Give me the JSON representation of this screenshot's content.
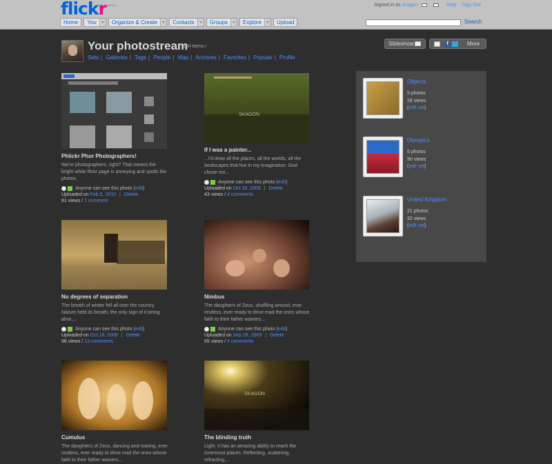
{
  "header": {
    "logo_main": "flick",
    "logo_r": "r",
    "logo_tag": "FROM YAHOO",
    "signed_in_label": "Signed in as",
    "signed_in_user": "skagon",
    "help": "Help",
    "sign_out": "Sign Out",
    "nav": [
      {
        "label": "Home",
        "dropdown": false
      },
      {
        "label": "You",
        "dropdown": true
      },
      {
        "label": "Organize & Create",
        "dropdown": true
      },
      {
        "label": "Contacts",
        "dropdown": true
      },
      {
        "label": "Groups",
        "dropdown": true
      },
      {
        "label": "Explore",
        "dropdown": true
      },
      {
        "label": "Upload",
        "dropdown": false
      }
    ],
    "search_value": "",
    "search_label": "Search"
  },
  "profile": {
    "title": "Your photostream",
    "count": "190 items /",
    "links": [
      "Sets",
      "Galleries",
      "Tags",
      "People",
      "Map",
      "Archives",
      "Favorites",
      "Popular",
      "Profile"
    ],
    "slideshow": "Slideshow",
    "more": "More"
  },
  "photos": [
    {
      "title": "Phlickr Phor Photographers!",
      "desc": "We're photographers, right? That means the bright white flickr page is annoying and spoils the photos.",
      "privacy": "Anyone can see this photo",
      "edit": "edit",
      "uploaded_label": "Uploaded on",
      "date": "Feb 5, 2010",
      "delete": "Delete",
      "views": "81 views /",
      "comments": "1 comment"
    },
    {
      "title": "If I was a painter...",
      "desc": "...I'd draw all the places, all the worlds, all the landscapes that live in my imagination. God chose not...",
      "privacy": "Anyone can see this photo",
      "edit": "edit",
      "uploaded_label": "Uploaded on",
      "date": "Oct 18, 2009",
      "delete": "Delete",
      "views": "43 views /",
      "comments": "4 comments"
    },
    {
      "title": "No degrees of separation",
      "desc": "The breath of winter fell all over the country. Nature held its breath; the only sign of it being alive,...",
      "privacy": "Anyone can see this photo",
      "edit": "edit",
      "uploaded_label": "Uploaded on",
      "date": "Oct 18, 2009",
      "delete": "Delete",
      "views": "96 views /",
      "comments": "13 comments"
    },
    {
      "title": "Nimbus",
      "desc": "The daughters of Zeus, shuffling around, ever restless, ever ready to drive mad the ones whose faith to their father waivers...",
      "privacy": "Anyone can see this photo",
      "edit": "edit",
      "uploaded_label": "Uploaded on",
      "date": "Sep 26, 2009",
      "delete": "Delete",
      "views": "65 views /",
      "comments": "5 comments"
    },
    {
      "title": "Cumulus",
      "desc": "The daughters of Zeus, dancing and roaring, ever restless, ever ready to drive mad the ones whose faith to their father waivers...",
      "privacy": "",
      "edit": "",
      "uploaded_label": "",
      "date": "",
      "delete": "",
      "views": "",
      "comments": ""
    },
    {
      "title": "The blinding truth",
      "desc": "Light. It has an amazing ability to reach the innermost places. Reflecting, scattering, refracting,...",
      "privacy": "",
      "edit": "",
      "uploaded_label": "",
      "date": "",
      "delete": "",
      "views": "",
      "comments": ""
    }
  ],
  "sets": [
    {
      "name": "Objects",
      "photos": "5 photos",
      "views": "28 views",
      "edit": "edit set"
    },
    {
      "name": "Olympics",
      "photos": "6 photos",
      "views": "90 views",
      "edit": "edit set"
    },
    {
      "name": "United Kingdom",
      "photos": "21 photos",
      "views": "32 views",
      "edit": "edit set"
    }
  ],
  "watermark": "SKAGON"
}
